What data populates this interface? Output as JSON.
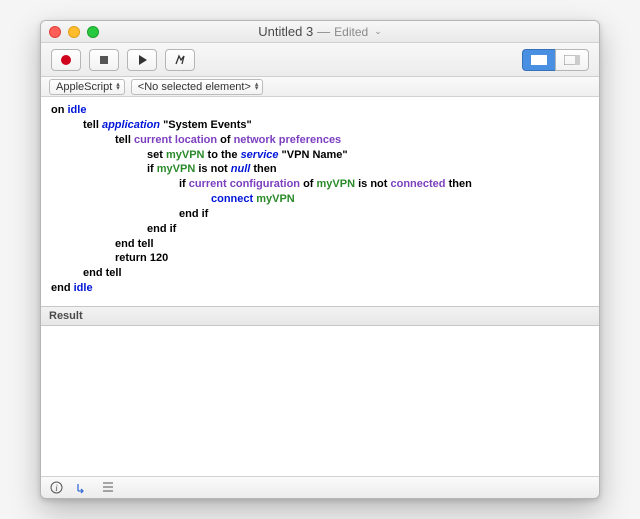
{
  "window": {
    "title": "Untitled 3",
    "edited_label": "Edited"
  },
  "toolbar": {
    "record": "record",
    "stop": "stop",
    "run": "run",
    "compile": "compile",
    "pane_left": "left pane",
    "pane_right": "right pane"
  },
  "subbar": {
    "language": "AppleScript",
    "element": "<No selected element>"
  },
  "code": {
    "l1_on": "on ",
    "l1_idle": "idle",
    "l2_tell": "tell ",
    "l2_app": "application",
    "l2_str": " \"System Events\"",
    "l3_tell": "tell ",
    "l3_curloc": "current location",
    "l3_of": " of ",
    "l3_netpref": "network preferences",
    "l4_set": "set ",
    "l4_var": "myVPN",
    "l4_to": " to the ",
    "l4_svc": "service",
    "l4_str": " \"VPN Name\"",
    "l5_if": "if ",
    "l5_var": "myVPN",
    "l5_isnot": " is not ",
    "l5_null": "null",
    "l5_then": " then",
    "l6_if": "if ",
    "l6_curcfg": "current configuration",
    "l6_of": " of ",
    "l6_var": "myVPN",
    "l6_isnot": " is not ",
    "l6_conn": "connected",
    "l6_then": " then",
    "l7_connect": "connect ",
    "l7_var": "myVPN",
    "l8": "end if",
    "l9": "end if",
    "l10": "end tell",
    "l11_ret": "return ",
    "l11_num": "120",
    "l12": "end tell",
    "l13_end": "end ",
    "l13_idle": "idle"
  },
  "result": {
    "header": "Result"
  },
  "status": {
    "info": "info",
    "events": "events",
    "list": "list"
  }
}
